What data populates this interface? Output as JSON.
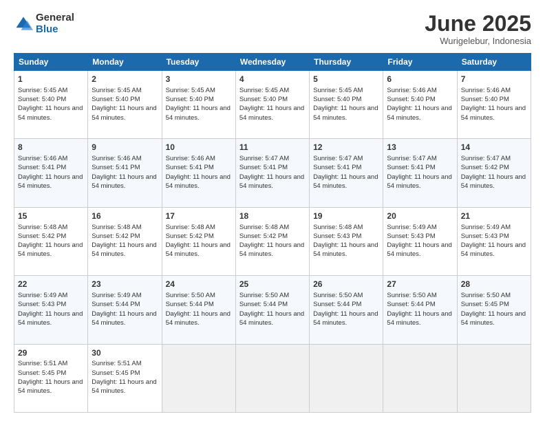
{
  "header": {
    "logo_general": "General",
    "logo_blue": "Blue",
    "title": "June 2025",
    "location": "Wurigelebur, Indonesia"
  },
  "weekdays": [
    "Sunday",
    "Monday",
    "Tuesday",
    "Wednesday",
    "Thursday",
    "Friday",
    "Saturday"
  ],
  "weeks": [
    [
      {
        "day": 1,
        "sunrise": "5:45 AM",
        "sunset": "5:40 PM",
        "daylight": "11 hours and 54 minutes."
      },
      {
        "day": 2,
        "sunrise": "5:45 AM",
        "sunset": "5:40 PM",
        "daylight": "11 hours and 54 minutes."
      },
      {
        "day": 3,
        "sunrise": "5:45 AM",
        "sunset": "5:40 PM",
        "daylight": "11 hours and 54 minutes."
      },
      {
        "day": 4,
        "sunrise": "5:45 AM",
        "sunset": "5:40 PM",
        "daylight": "11 hours and 54 minutes."
      },
      {
        "day": 5,
        "sunrise": "5:45 AM",
        "sunset": "5:40 PM",
        "daylight": "11 hours and 54 minutes."
      },
      {
        "day": 6,
        "sunrise": "5:46 AM",
        "sunset": "5:40 PM",
        "daylight": "11 hours and 54 minutes."
      },
      {
        "day": 7,
        "sunrise": "5:46 AM",
        "sunset": "5:40 PM",
        "daylight": "11 hours and 54 minutes."
      }
    ],
    [
      {
        "day": 8,
        "sunrise": "5:46 AM",
        "sunset": "5:41 PM",
        "daylight": "11 hours and 54 minutes."
      },
      {
        "day": 9,
        "sunrise": "5:46 AM",
        "sunset": "5:41 PM",
        "daylight": "11 hours and 54 minutes."
      },
      {
        "day": 10,
        "sunrise": "5:46 AM",
        "sunset": "5:41 PM",
        "daylight": "11 hours and 54 minutes."
      },
      {
        "day": 11,
        "sunrise": "5:47 AM",
        "sunset": "5:41 PM",
        "daylight": "11 hours and 54 minutes."
      },
      {
        "day": 12,
        "sunrise": "5:47 AM",
        "sunset": "5:41 PM",
        "daylight": "11 hours and 54 minutes."
      },
      {
        "day": 13,
        "sunrise": "5:47 AM",
        "sunset": "5:41 PM",
        "daylight": "11 hours and 54 minutes."
      },
      {
        "day": 14,
        "sunrise": "5:47 AM",
        "sunset": "5:42 PM",
        "daylight": "11 hours and 54 minutes."
      }
    ],
    [
      {
        "day": 15,
        "sunrise": "5:48 AM",
        "sunset": "5:42 PM",
        "daylight": "11 hours and 54 minutes."
      },
      {
        "day": 16,
        "sunrise": "5:48 AM",
        "sunset": "5:42 PM",
        "daylight": "11 hours and 54 minutes."
      },
      {
        "day": 17,
        "sunrise": "5:48 AM",
        "sunset": "5:42 PM",
        "daylight": "11 hours and 54 minutes."
      },
      {
        "day": 18,
        "sunrise": "5:48 AM",
        "sunset": "5:42 PM",
        "daylight": "11 hours and 54 minutes."
      },
      {
        "day": 19,
        "sunrise": "5:48 AM",
        "sunset": "5:43 PM",
        "daylight": "11 hours and 54 minutes."
      },
      {
        "day": 20,
        "sunrise": "5:49 AM",
        "sunset": "5:43 PM",
        "daylight": "11 hours and 54 minutes."
      },
      {
        "day": 21,
        "sunrise": "5:49 AM",
        "sunset": "5:43 PM",
        "daylight": "11 hours and 54 minutes."
      }
    ],
    [
      {
        "day": 22,
        "sunrise": "5:49 AM",
        "sunset": "5:43 PM",
        "daylight": "11 hours and 54 minutes."
      },
      {
        "day": 23,
        "sunrise": "5:49 AM",
        "sunset": "5:44 PM",
        "daylight": "11 hours and 54 minutes."
      },
      {
        "day": 24,
        "sunrise": "5:50 AM",
        "sunset": "5:44 PM",
        "daylight": "11 hours and 54 minutes."
      },
      {
        "day": 25,
        "sunrise": "5:50 AM",
        "sunset": "5:44 PM",
        "daylight": "11 hours and 54 minutes."
      },
      {
        "day": 26,
        "sunrise": "5:50 AM",
        "sunset": "5:44 PM",
        "daylight": "11 hours and 54 minutes."
      },
      {
        "day": 27,
        "sunrise": "5:50 AM",
        "sunset": "5:44 PM",
        "daylight": "11 hours and 54 minutes."
      },
      {
        "day": 28,
        "sunrise": "5:50 AM",
        "sunset": "5:45 PM",
        "daylight": "11 hours and 54 minutes."
      }
    ],
    [
      {
        "day": 29,
        "sunrise": "5:51 AM",
        "sunset": "5:45 PM",
        "daylight": "11 hours and 54 minutes."
      },
      {
        "day": 30,
        "sunrise": "5:51 AM",
        "sunset": "5:45 PM",
        "daylight": "11 hours and 54 minutes."
      },
      null,
      null,
      null,
      null,
      null
    ]
  ]
}
